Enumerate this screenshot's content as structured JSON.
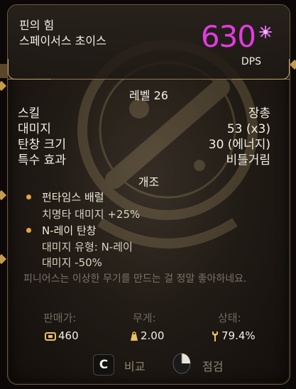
{
  "header": {
    "weapon_name": "핀의 힘",
    "brand_name": "스페이서스 초이스",
    "dps_value": "630",
    "dps_label": "DPS",
    "dps_icon": "plasma-burst-icon"
  },
  "level": "레벨 26",
  "stats": [
    {
      "label": "스킬",
      "value": "장총"
    },
    {
      "label": "대미지",
      "value": "53 (x3)"
    },
    {
      "label": "탄창 크기",
      "value": "30 (에너지)"
    },
    {
      "label": "특수 효과",
      "value": "비틀거림"
    }
  ],
  "mods": {
    "title": "개조",
    "items": [
      {
        "name": "펀타임스 배럴",
        "details": [
          "치명타 대미지 +25%"
        ]
      },
      {
        "name": "N-레이 탄창",
        "details": [
          "대미지 유형: N-레이",
          "대미지 -50%"
        ]
      }
    ]
  },
  "flavor_text": "피니어스는 이상한 무기를 만드는 걸 정말 좋아하네요.",
  "footer": {
    "price_label": "판매가:",
    "price_value": "460",
    "weight_label": "무게:",
    "weight_value": "2.00",
    "condition_label": "상태:",
    "condition_value": "79.4%"
  },
  "actions": {
    "compare_key": "C",
    "compare_label": "비교",
    "inspect_label": "점검"
  },
  "colors": {
    "dps": "#e23be0",
    "accent_gold": "#e4a53c",
    "muted": "#7a7366"
  }
}
